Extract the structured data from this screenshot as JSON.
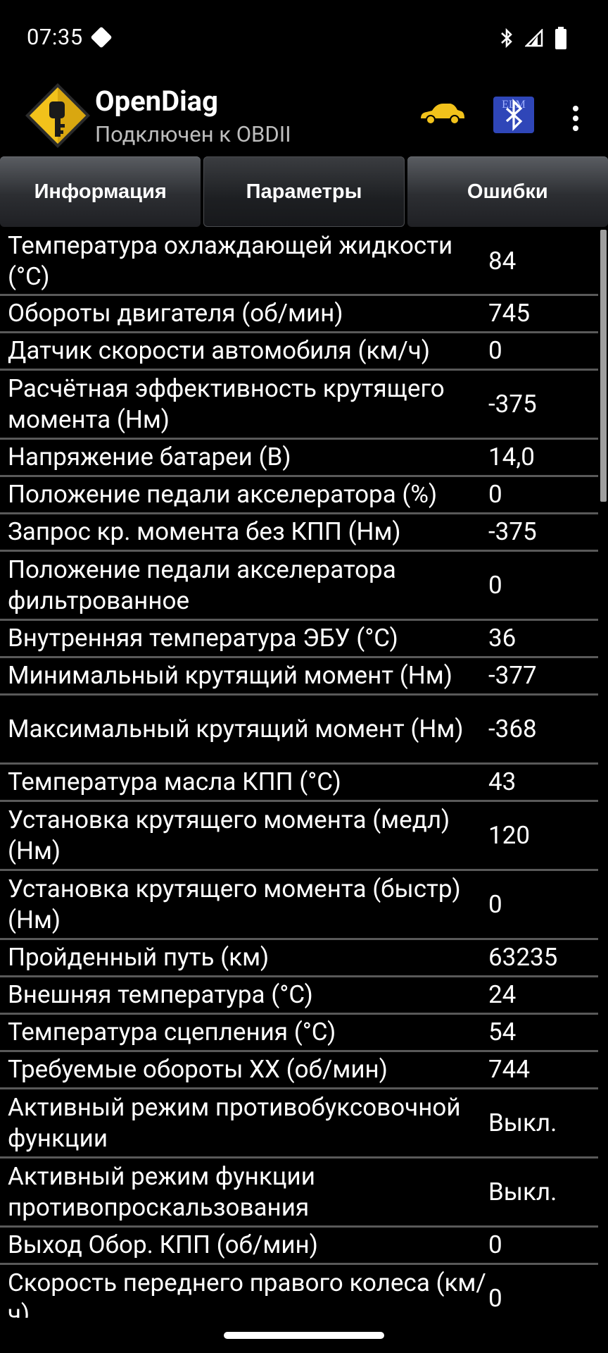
{
  "status_bar": {
    "time": "07:35"
  },
  "app": {
    "title": "OpenDiag",
    "subtitle": "Подключен к OBDII"
  },
  "icons": {
    "bluetooth_badge_text": "ELM"
  },
  "tabs": [
    {
      "label": "Информация"
    },
    {
      "label": "Параметры",
      "active": true
    },
    {
      "label": "Ошибки"
    }
  ],
  "rows": [
    {
      "label": "Температура охлаждающей жидкости (°С)",
      "value": "84"
    },
    {
      "label": "Обороты двигателя (об/мин)",
      "value": "745"
    },
    {
      "label": "Датчик скорости автомобиля (км/ч)",
      "value": "0"
    },
    {
      "label": "Расчётная эффективность крутящего момента (Нм)",
      "value": "-375"
    },
    {
      "label": "Напряжение батареи (В)",
      "value": "14,0"
    },
    {
      "label": "Положение педали акселератора (%)",
      "value": "0"
    },
    {
      "label": "Запрос кр. момента без КПП (Нм)",
      "value": "-375"
    },
    {
      "label": "Положение педали акселератора фильтрованное",
      "value": "0"
    },
    {
      "label": "Внутренняя температура ЭБУ (°С)",
      "value": "36"
    },
    {
      "label": "Минимальный крутящий момент (Нм)",
      "value": "-377"
    },
    {
      "label": "Максимальный крутящий момент (Нм)",
      "value": "-368"
    },
    {
      "label": "Температура масла КПП (°С)",
      "value": "43"
    },
    {
      "label": "Установка крутящего момента (медл) (Нм)",
      "value": "120"
    },
    {
      "label": "Установка крутящего момента (быстр) (Нм)",
      "value": "0"
    },
    {
      "label": "Пройденный путь (км)",
      "value": "63235"
    },
    {
      "label": "Внешняя температура (°С)",
      "value": "24"
    },
    {
      "label": "Температура сцепления (°С)",
      "value": "54"
    },
    {
      "label": "Требуемые обороты ХХ (об/мин)",
      "value": "744"
    },
    {
      "label": "Активный режим противобуксовочной функции",
      "value": "Выкл."
    },
    {
      "label": "Активный режим функции противопроскальзования",
      "value": "Выкл."
    },
    {
      "label": "Выход Обор. КПП (об/мин)",
      "value": "0"
    },
    {
      "label": "Скорость переднего правого колеса (км/ч)",
      "value": "0"
    }
  ]
}
